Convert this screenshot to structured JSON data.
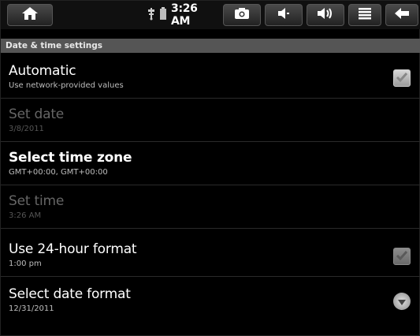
{
  "status_bar": {
    "time": "3:26 AM",
    "icons": [
      "home-icon",
      "usb-icon",
      "battery-icon",
      "camera-icon",
      "volume-down-icon",
      "volume-up-icon",
      "menu-icon",
      "back-icon"
    ]
  },
  "header": {
    "title": "Date & time settings"
  },
  "settings": [
    {
      "title": "Automatic",
      "summary": "Use network-provided values",
      "enabled": true,
      "control": "checkbox",
      "checked": true
    },
    {
      "title": "Set date",
      "summary": "3/8/2011",
      "enabled": false
    },
    {
      "title": "Select time zone",
      "summary": "GMT+00:00, GMT+00:00",
      "enabled": true
    },
    {
      "title": "Set time",
      "summary": "3:26 AM",
      "enabled": false
    },
    {
      "title": "Use 24-hour format",
      "summary": "1:00 pm",
      "enabled": true,
      "control": "checkbox",
      "checked": true
    },
    {
      "title": "Select date format",
      "summary": "12/31/2011",
      "enabled": true,
      "control": "dropdown"
    }
  ],
  "colors": {
    "background": "#000000",
    "header_bar": "#555555",
    "disabled_text": "#666666"
  }
}
